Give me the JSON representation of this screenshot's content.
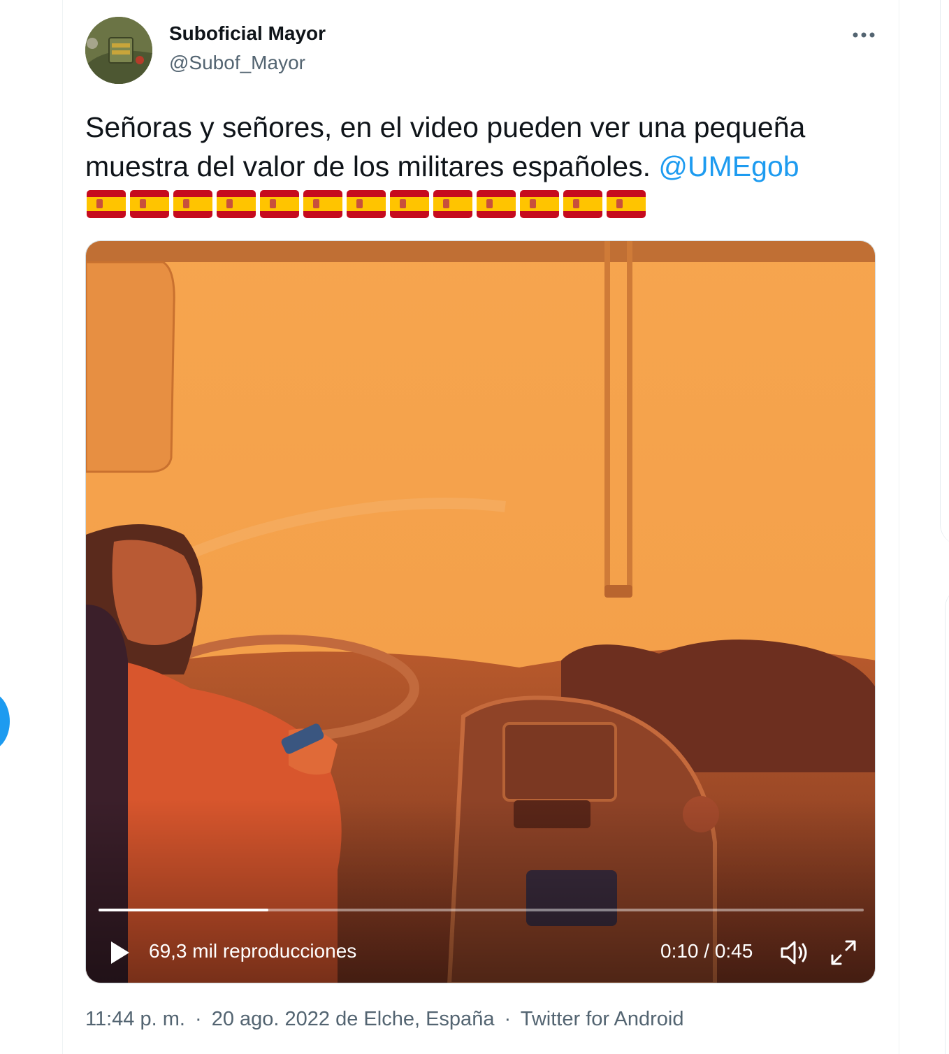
{
  "tweet": {
    "author": {
      "display_name": "Suboficial Mayor",
      "handle": "@Subof_Mayor"
    },
    "more_icon": "more-horizontal-icon",
    "text": "Señoras y señores, en el video pueden ver una pequeña muestra del valor de los militares españoles.",
    "mention": "@UMEgob",
    "flag_emoji": "🇪🇸",
    "flag_count": 13,
    "video": {
      "views": "69,3 mil reproducciones",
      "timecode": "0:10 / 0:45",
      "progress": 0.222,
      "icons": [
        "play-icon",
        "volume-icon",
        "fullscreen-icon"
      ]
    },
    "meta": {
      "time": "11:44 p. m.",
      "separator": "·",
      "date": "20 ago. 2022 de Elche, España",
      "source": "Twitter for Android"
    }
  },
  "colors": {
    "accent": "#1d9bf0",
    "text_primary": "#0f1419",
    "text_secondary": "#536471",
    "video_tint": "#f2a046"
  }
}
